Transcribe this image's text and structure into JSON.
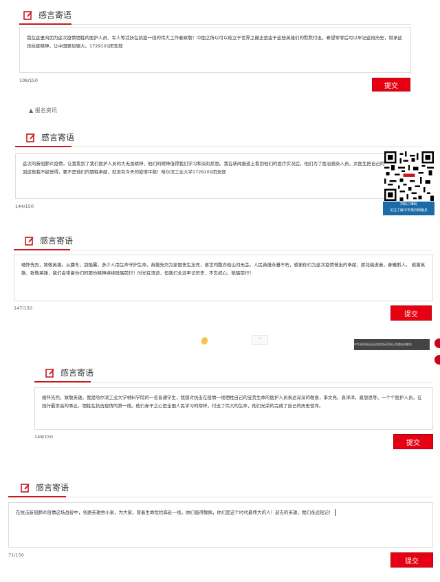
{
  "colors": {
    "accent": "#c8161d",
    "submit_bg": "#e60012",
    "qr_caption_bg": "#1a6ba8"
  },
  "icon_names": {
    "edit": "edit-icon",
    "qr": "qr-code-icon"
  },
  "panels": [
    {
      "title": "感言寄语",
      "text": "我在这里向因为这次疫情牺牲的医护人员、军人等活跃在抗疫一线的伟大工作者致敬！中国之所以可以屹立于世界之巅正是由于这些英雄们的默默付出，希望零零后可以牢记这段历史，继承这段抗疫精神，让中国更加强大。1729101团支部",
      "count": "108/150",
      "submit": "提交"
    },
    {
      "title": "感言寄语",
      "text": "这次的新冠肺炎疫情，让我看到了我们医护人员的大无畏精神，他们的精神值得我们学习和深刻反思。我在新闻报道上看到他们的医疗实况后，他们为了医治感染人员，女医生把自己的头发剪了，看到这些我不经觉得，要不是他们的牺牲奉献，就没有今天的疫情平稳！哈尔滨工业大学1729101团支部",
      "count": "144/150",
      "submit": "提交"
    },
    {
      "title": "感言寄语",
      "text": "缅怀先烈，致敬英雄。从麋冬，到酷暑，多少人用生命守护生命。英雄先烈为家国舍生忘死，逝世同胞亦勋山河无恙。人民英雄永垂不朽，感谢你们为这次疫情做出的奉献，愿花樯逝者，春暖斯人。 感谢英雄，致敬英雄，我们会带着你们的那份精神继续砥砺前行！时光在流逝，但我们永远牢记历史，不忘初心，砥砺前行！",
      "count": "147/150",
      "submit": "提交"
    },
    {
      "title": "感言寄语",
      "text": "缅怀先烈，致敬英雄。我是哈尔滨工业大学材料学院的一名普通学生，我想对抗击在疫情一线牺牲自己的宝贵生命的医护人员表达深深的敬意，李文亮，袁洋洋，夏思思等，一个个医护人员，在践行最崇高的事业，牺牲在抗击疫情的第一线。他们赤子之心是全国人民学习的榜样，付出了伟大的生命，他们光荣的完成了自己的历史使命。",
      "count": "148/150",
      "submit": "提交"
    },
    {
      "title": "感言寄语",
      "text": "在抗击新冠肺炎疫情这场战役中，各路英雄舍小家，为大家，冒着生命危险奔赴一线，你们值得敬佩，你们是这个时代最伟大的人！逝去的英雄，我们永远铭记！",
      "count": "71/150",
      "submit": "提交"
    }
  ],
  "qr_caption": {
    "line1": "扫码二维码",
    "line2": "关注了解中华英烈网最多"
  },
  "fragment": "▲  报名资讯",
  "banner_text": "中华英烈网纪念英烈追思英烈网上祭奠在线献花"
}
